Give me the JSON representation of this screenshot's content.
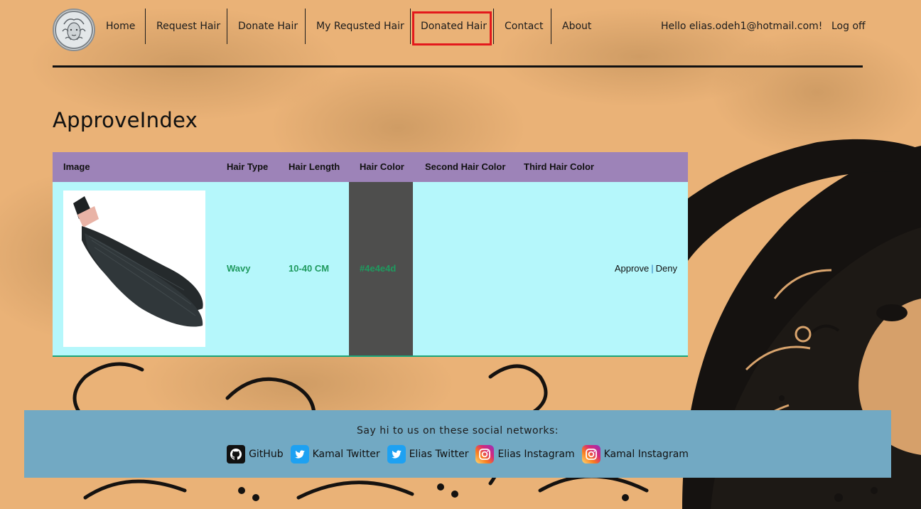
{
  "nav": {
    "items": [
      {
        "label": "Home"
      },
      {
        "label": "Request Hair"
      },
      {
        "label": "Donate Hair"
      },
      {
        "label": "My Requsted Hair"
      },
      {
        "label": "Donated Hair"
      },
      {
        "label": "Contact"
      },
      {
        "label": "About"
      }
    ],
    "greeting": "Hello elias.odeh1@hotmail.com!",
    "logoff": "Log off",
    "logo_icon": "medusa-logo-icon"
  },
  "page": {
    "title": "ApproveIndex"
  },
  "table": {
    "columns": [
      "Image",
      "Hair Type",
      "Hair Length",
      "Hair Color",
      "Second Hair Color",
      "Third Hair Color"
    ],
    "rows": [
      {
        "image_icon": "hair-extension-image",
        "hair_type": "Wavy",
        "hair_length": "10-40 CM",
        "hair_color": "#4e4e4d",
        "second_hair_color": "",
        "third_hair_color": "",
        "approve": "Approve",
        "separator": "|",
        "deny": "Deny"
      }
    ]
  },
  "footer": {
    "text": "Say hi to us on these social networks:",
    "links": [
      {
        "label": "GitHub",
        "icon": "github-icon"
      },
      {
        "label": "Kamal Twitter",
        "icon": "twitter-icon"
      },
      {
        "label": "Elias Twitter",
        "icon": "twitter-icon"
      },
      {
        "label": "Elias Instagram",
        "icon": "instagram-icon"
      },
      {
        "label": "Kamal Instagram",
        "icon": "instagram-icon"
      }
    ]
  },
  "colors": {
    "background": "#eab277",
    "table_header": "#9d83b8",
    "table_row": "#b5f7fb",
    "cell_text": "#1f9a5f",
    "footer": "#72a9c3",
    "nav_highlight": "#e3191c"
  }
}
